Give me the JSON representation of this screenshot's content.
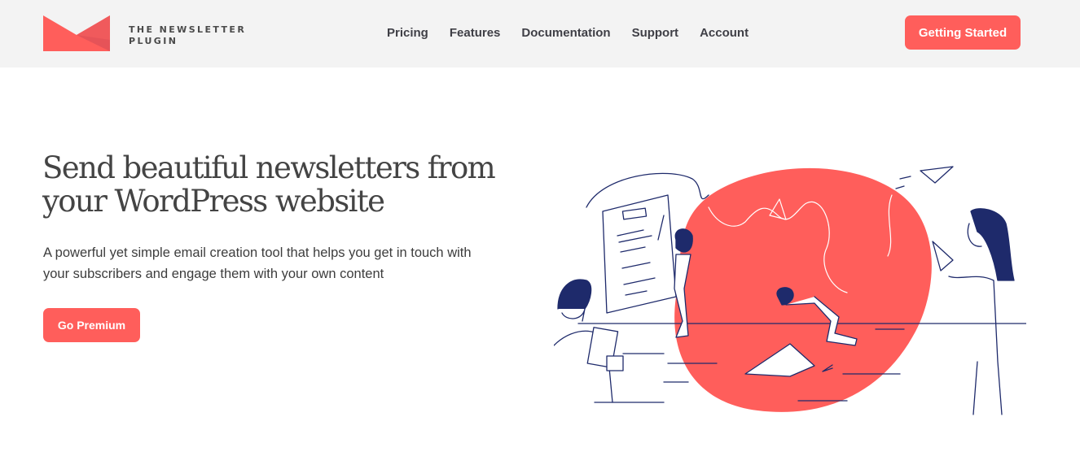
{
  "header": {
    "logo": {
      "line1": "THE NEWSLETTER",
      "line2": "PLUGIN",
      "icon": "envelope-icon"
    },
    "nav": [
      {
        "label": "Pricing"
      },
      {
        "label": "Features"
      },
      {
        "label": "Documentation"
      },
      {
        "label": "Support"
      },
      {
        "label": "Account"
      }
    ],
    "cta_label": "Getting Started"
  },
  "hero": {
    "title_line1": "Send beautiful newsletters from",
    "title_line2": "your WordPress website",
    "subtitle_line1": "A powerful yet simple email creation tool that helps you get in touch with",
    "subtitle_line2": "your subscribers and engage them with your own content",
    "cta_label": "Go Premium",
    "illustration": "team-creating-newsletter-illustration"
  },
  "colors": {
    "accent": "#ff5e5b",
    "header_bg": "#f3f3f3",
    "illustration_ink": "#1e2a6b"
  }
}
